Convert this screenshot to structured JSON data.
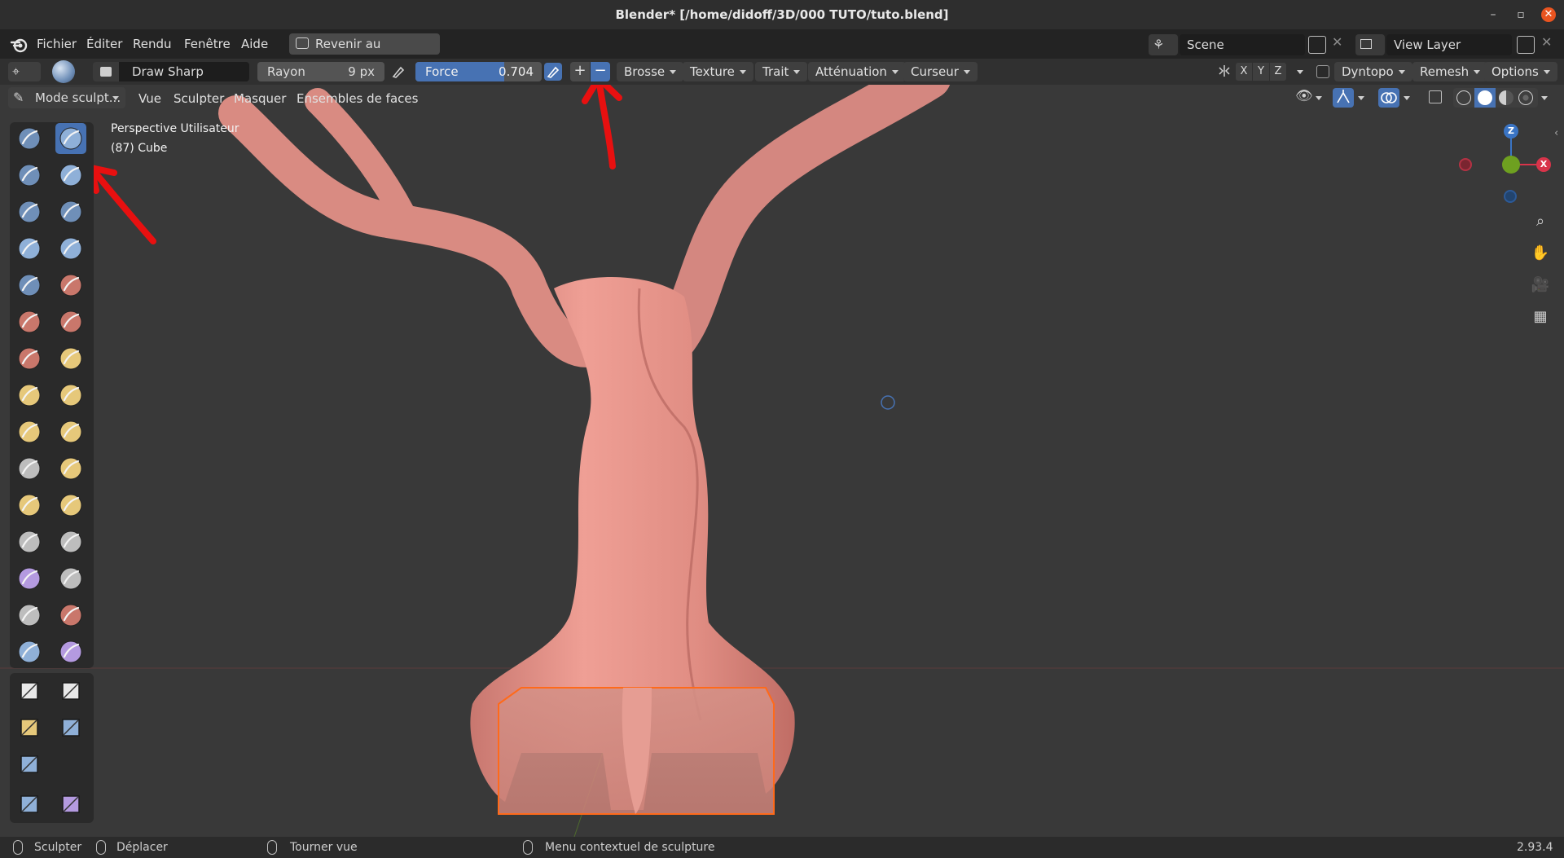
{
  "window": {
    "title": "Blender* [/home/didoff/3D/000 TUTO/tuto.blend]",
    "minimize_glyph": "–",
    "maximize_glyph": "▫",
    "close_glyph": "✕"
  },
  "menubar": {
    "items": [
      "Fichier",
      "Éditer",
      "Rendu",
      "Fenêtre",
      "Aide"
    ],
    "revert_label": "Revenir au précédent",
    "scene_value": "Scene",
    "view_layer_value": "View Layer"
  },
  "toolheader": {
    "brush_name": "Draw Sharp",
    "radius_label": "Rayon",
    "radius_value": "9 px",
    "strength_label": "Force",
    "strength_value": "0.704",
    "strength_fraction": 0.704,
    "plus_glyph": "+",
    "minus_glyph": "−",
    "menus": [
      "Brosse",
      "Texture",
      "Trait",
      "Atténuation",
      "Curseur"
    ],
    "axis_x": "X",
    "axis_y": "Y",
    "axis_z": "Z",
    "dyntopo_label": "Dyntopo",
    "remesh_label": "Remesh",
    "options_label": "Options"
  },
  "viewport_header": {
    "mode_label": "Mode sculpt...",
    "menus": [
      "Vue",
      "Sculpter",
      "Masquer",
      "Ensembles de faces"
    ]
  },
  "viewport": {
    "view_name": "Perspective Utilisateur",
    "object_info": "(87) Cube",
    "gizmo": {
      "x": "X",
      "y": "Y",
      "z": "Z"
    }
  },
  "colors": {
    "accent": "#4772b3",
    "mesh": "#e3968c",
    "annotation": "#e81010",
    "selection": "#ff6a1a"
  },
  "statusbar": {
    "left_action": "Sculpter",
    "middle_action": "Déplacer",
    "rotate_action": "Tourner vue",
    "context_action": "Menu contextuel de sculpture",
    "version": "2.93.4"
  }
}
